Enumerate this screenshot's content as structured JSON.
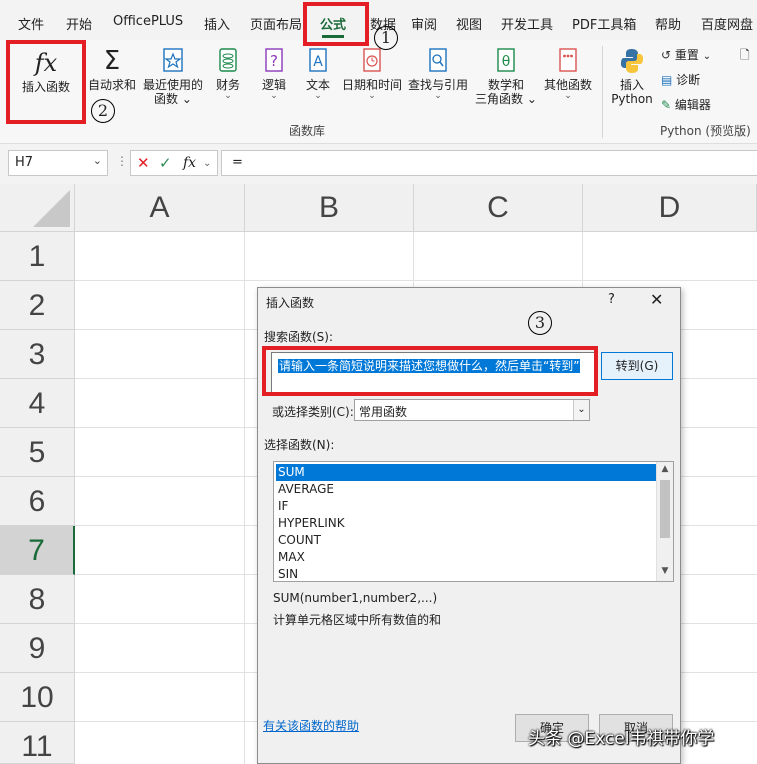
{
  "menu": {
    "tabs": [
      "文件",
      "开始",
      "OfficePLUS",
      "插入",
      "页面布局",
      "公式",
      "数据",
      "审阅",
      "视图",
      "开发工具",
      "PDF工具箱",
      "帮助",
      "百度网盘"
    ],
    "active_tab": "公式"
  },
  "ribbon": {
    "insert_function": "插入函数",
    "fx_symbol": "fx",
    "autosum_line1": "自动求和",
    "recent_line1": "最近使用的",
    "recent_line2": "函数",
    "financial": "财务",
    "logical": "逻辑",
    "text": "文本",
    "datetime": "日期和时间",
    "lookup": "查找与引用",
    "math_line1": "数学和",
    "math_line2": "三角函数",
    "other": "其他函数",
    "group_label": "函数库",
    "python_line1": "插入",
    "python_line2": "Python",
    "reset": "重置",
    "diagnose": "诊断",
    "editor": "编辑器",
    "python_group_label": "Python (预览版)"
  },
  "formula_bar": {
    "name_box": "H7",
    "fx": "fx",
    "value": "="
  },
  "grid": {
    "columns": [
      "A",
      "B",
      "C",
      "D"
    ],
    "rows": [
      "1",
      "2",
      "3",
      "4",
      "5",
      "6",
      "7",
      "8",
      "9",
      "10",
      "11"
    ],
    "selected_row": "7"
  },
  "dialog": {
    "title": "插入函数",
    "help": "?",
    "close": "✕",
    "search_label": "搜索函数(S):",
    "search_value": "请输入一条简短说明来描述您想做什么，然后单击“转到”",
    "goto_button": "转到(G)",
    "category_label": "或选择类别(C):",
    "category_value": "常用函数",
    "select_label": "选择函数(N):",
    "functions": [
      "SUM",
      "AVERAGE",
      "IF",
      "HYPERLINK",
      "COUNT",
      "MAX",
      "SIN"
    ],
    "selected_function": "SUM",
    "syntax": "SUM(number1,number2,...)",
    "description": "计算单元格区域中所有数值的和",
    "help_link": "有关该函数的帮助",
    "ok_button": "确定",
    "cancel_button": "取消"
  },
  "annotations": {
    "step1": "1",
    "step2": "2",
    "step3": "3",
    "red_color": "#e31e24"
  },
  "watermark": "头条 @Excel韦祺带你学"
}
